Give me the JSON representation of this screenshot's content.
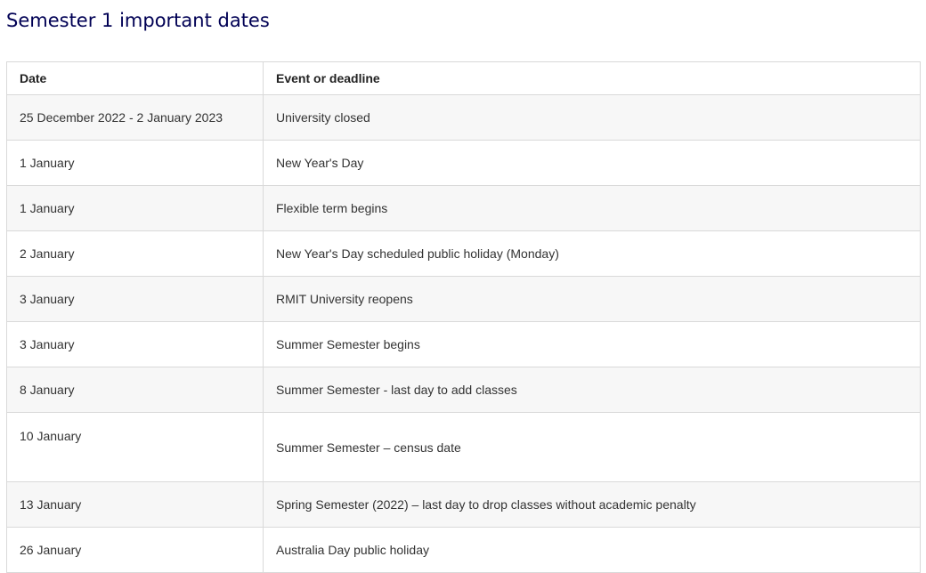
{
  "page": {
    "title": "Semester 1 important dates"
  },
  "table": {
    "headers": {
      "date": "Date",
      "event": "Event or deadline"
    },
    "rows": [
      {
        "date": "25 December 2022 - 2 January 2023",
        "event": "University closed"
      },
      {
        "date": "1 January",
        "event": "New Year's Day"
      },
      {
        "date": "1 January",
        "event": "Flexible term begins"
      },
      {
        "date": "2 January",
        "event": "New Year's Day scheduled public holiday (Monday)"
      },
      {
        "date": "3 January",
        "event": "RMIT University reopens"
      },
      {
        "date": "3 January",
        "event": "Summer Semester begins"
      },
      {
        "date": "8 January",
        "event": "Summer Semester - last day to add classes"
      },
      {
        "date": "10 January",
        "event": "Summer Semester – census date"
      },
      {
        "date": "13 January",
        "event": "Spring Semester (2022) – last day to drop classes without academic penalty"
      },
      {
        "date": "26 January",
        "event": "Australia Day public holiday"
      }
    ]
  },
  "colors": {
    "title": "#000054",
    "border": "#d9d9d9",
    "stripe": "#f7f7f7",
    "text": "#333333"
  }
}
